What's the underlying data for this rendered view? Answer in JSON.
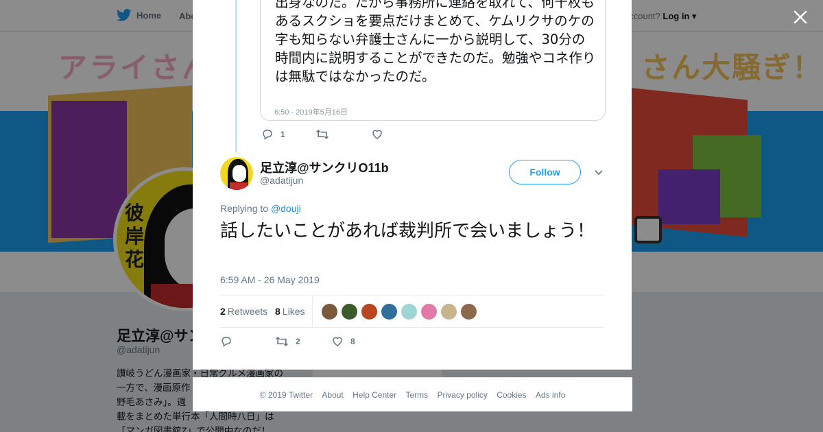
{
  "topnav": {
    "home_label": "Home",
    "about_label": "Abo",
    "account_text": "account?",
    "login_label": "Log in"
  },
  "banner": {
    "title_left": "アライさん",
    "title_right": "さん大騒ぎ！"
  },
  "profile": {
    "name": "足立淳@サン",
    "handle": "@adatijun",
    "bio_lines": [
      "讃岐うどん漫画家・日常グルメ漫画家の",
      "一方で、漫画原作",
      "野毛あさみ」。週",
      "載をまとめた単行本「人間時八日」は",
      "「マンガ図書館Z」で公開中なのだ！"
    ]
  },
  "quoted_tweet": {
    "text": "出身なのだ。たから事務所に連絡を取れて、何十枚もあるスクショを要点だけまとめて、ケムリクサのケの字も知らない弁護士さんに一から説明して、30分の時間内に説明することができたのだ。勉強やコネ作りは無駄ではなかったのだ。",
    "date": "6:50 - 2019年5月16日",
    "reply_count": "1"
  },
  "tweet": {
    "author_name": "足立淳@サンクリO11b",
    "author_handle": "@adatijun",
    "follow_label": "Follow",
    "replying_prefix": "Replying to",
    "replying_to": "@douji",
    "text": "話したいことがあれば裁判所で会いましょう！",
    "timestamp": "6:59 AM - 26 May 2019",
    "retweets_count": "2",
    "retweets_label": "Retweets",
    "likes_count": "8",
    "likes_label": "Likes",
    "action_retweet_count": "2",
    "action_like_count": "8"
  },
  "likers": [
    {
      "color": "#7a5a3c"
    },
    {
      "color": "#3d5a2a"
    },
    {
      "color": "#b8461f"
    },
    {
      "color": "#2f6f9a"
    },
    {
      "color": "#9ed6d8"
    },
    {
      "color": "#e27aa8"
    },
    {
      "color": "#c8b48a"
    },
    {
      "color": "#8a6a4a"
    }
  ],
  "footer": {
    "copyright": "© 2019 Twitter",
    "links": [
      "About",
      "Help Center",
      "Terms",
      "Privacy policy",
      "Cookies",
      "Ads info"
    ]
  },
  "colors": {
    "twitter_blue": "#1da1f2",
    "link_blue": "#1b95e0",
    "secondary_text": "#657786",
    "thread_line": "#c4e4fa"
  },
  "icons": {
    "close": "close-icon",
    "twitter": "twitter-bird-icon",
    "reply": "reply-icon",
    "retweet": "retweet-icon",
    "like": "heart-icon",
    "caret": "chevron-down-icon"
  }
}
